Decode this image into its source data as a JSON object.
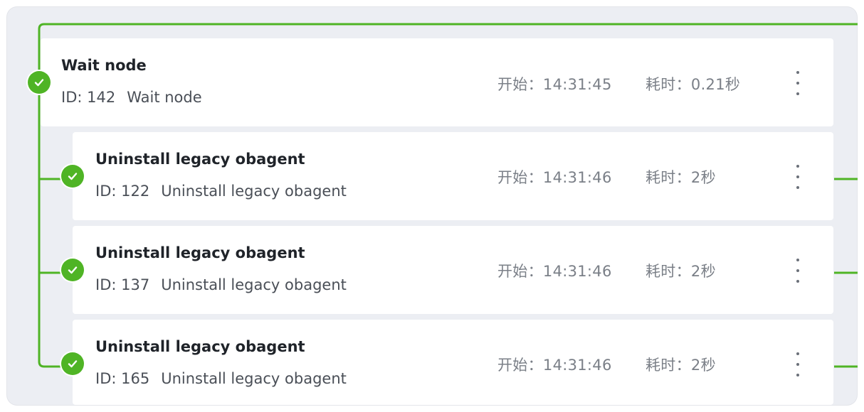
{
  "colors": {
    "accent_green": "#4fb425",
    "panel_bg": "#eceef3",
    "card_bg": "#ffffff"
  },
  "nodes": [
    {
      "title": "Wait node",
      "id_label": "ID: 142",
      "name": "Wait node",
      "start_label": "开始：",
      "start_time": "14:31:45",
      "duration_label": "耗时：",
      "duration": "0.21秒",
      "status_icon": "check-circle-icon",
      "menu_icon": "more-vertical-icon"
    },
    {
      "title": "Uninstall legacy obagent",
      "id_label": "ID: 122",
      "name": "Uninstall legacy obagent",
      "start_label": "开始：",
      "start_time": "14:31:46",
      "duration_label": "耗时：",
      "duration": "2秒",
      "status_icon": "check-circle-icon",
      "menu_icon": "more-vertical-icon"
    },
    {
      "title": "Uninstall legacy obagent",
      "id_label": "ID: 137",
      "name": "Uninstall legacy obagent",
      "start_label": "开始：",
      "start_time": "14:31:46",
      "duration_label": "耗时：",
      "duration": "2秒",
      "status_icon": "check-circle-icon",
      "menu_icon": "more-vertical-icon"
    },
    {
      "title": "Uninstall legacy obagent",
      "id_label": "ID: 165",
      "name": "Uninstall legacy obagent",
      "start_label": "开始：",
      "start_time": "14:31:46",
      "duration_label": "耗时：",
      "duration": "2秒",
      "status_icon": "check-circle-icon",
      "menu_icon": "more-vertical-icon"
    }
  ]
}
